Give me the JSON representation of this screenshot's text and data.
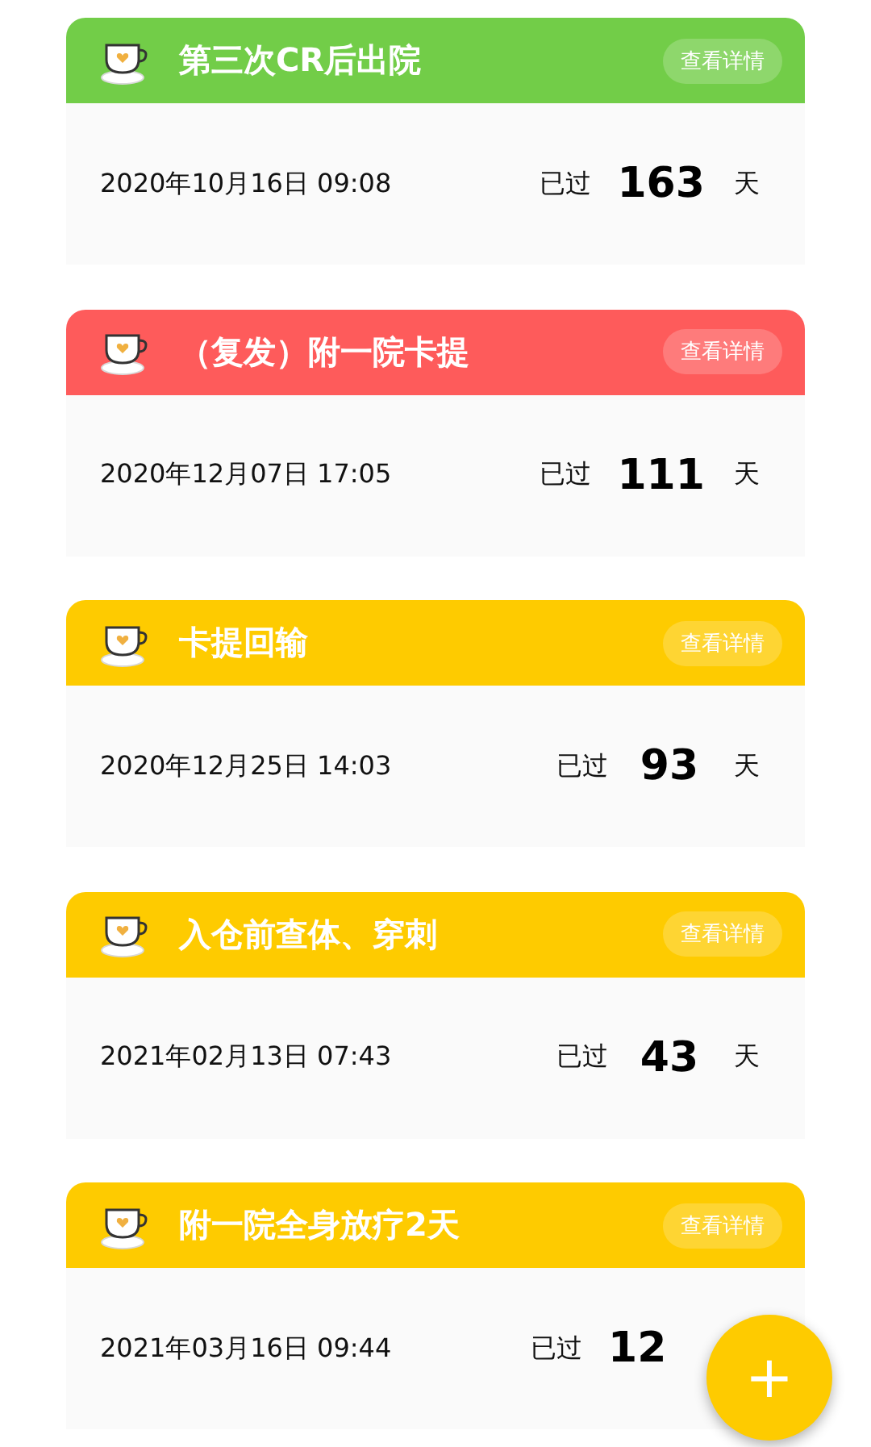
{
  "cards": [
    {
      "title": "第三次CR后出院",
      "color": "#72cd48",
      "detail_button": "查看详情",
      "date": "2020年10月16日 09:08",
      "elapsed_label": "已过",
      "days": "163",
      "unit": "天"
    },
    {
      "title": "（复发）附一院卡提",
      "color": "#fe5b5b",
      "detail_button": "查看详情",
      "date": "2020年12月07日 17:05",
      "elapsed_label": "已过",
      "days": "111",
      "unit": "天"
    },
    {
      "title": "卡提回输",
      "color": "#fecb00",
      "detail_button": "查看详情",
      "date": "2020年12月25日 14:03",
      "elapsed_label": "已过",
      "days": "93",
      "unit": "天"
    },
    {
      "title": "入仓前查体、穿刺",
      "color": "#fecb00",
      "detail_button": "查看详情",
      "date": "2021年02月13日 07:43",
      "elapsed_label": "已过",
      "days": "43",
      "unit": "天"
    },
    {
      "title": "附一院全身放疗2天",
      "color": "#fecb00",
      "detail_button": "查看详情",
      "date": "2021年03月16日 09:44",
      "elapsed_label": "已过",
      "days": "12"
    }
  ],
  "fab": {
    "label": "+"
  }
}
